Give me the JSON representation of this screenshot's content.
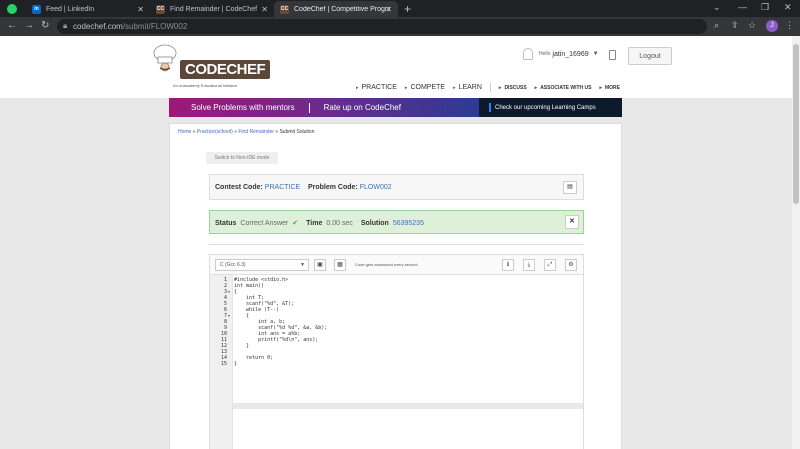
{
  "browser": {
    "tabs": [
      {
        "title": "Feed | LinkedIn",
        "favicon": "linkedin-icon"
      },
      {
        "title": "Find Remainder | CodeChef",
        "favicon": "codechef-icon"
      },
      {
        "title": "CodeChef | Competitive Programm",
        "favicon": "codechef-icon"
      }
    ],
    "url_host": "codechef.com",
    "url_path": "/submit/FLOW002",
    "profile_initial": "J"
  },
  "header": {
    "logo_text": "CODECHEF",
    "logo_sub": "An unacademy Educational Initiative",
    "hello": "Hello",
    "username": "jatin_16969",
    "logout_label": "Logout",
    "nav": [
      "PRACTICE",
      "COMPETE",
      "LEARN"
    ],
    "nav_small": [
      "DISCUSS",
      "ASSOCIATE WITH US",
      "MORE"
    ]
  },
  "banner": {
    "left1": "Solve Problems with mentors",
    "left2": "Rate up on CodeChef",
    "right": "Check our upcoming Learning Camps"
  },
  "breadcrumb": {
    "home": "Home",
    "practice": "Practice(school)",
    "problem": "Find Remainder",
    "current": "Submit Solution",
    "sep": " » "
  },
  "switch_label": "Switch to Non-IDE mode",
  "contest": {
    "contest_label": "Contest Code:",
    "contest_value": "PRACTICE",
    "problem_label": "Problem Code:",
    "problem_value": "FLOW002"
  },
  "status": {
    "status_label": "Status",
    "status_value": "Correct Answer",
    "time_label": "Time",
    "time_value": "0.00 sec",
    "solution_label": "Solution",
    "solution_value": "56395235"
  },
  "editor": {
    "language": "C (Gcc 6.3)",
    "autosave_text": "Code gets autosaved every second",
    "line_numbers": [
      "1",
      "2",
      "3",
      "4",
      "5",
      "6",
      "7",
      "8",
      "9",
      "10",
      "11",
      "12",
      "13",
      "14",
      "15"
    ],
    "lines": [
      "#include <stdio.h>",
      "int main()",
      "{",
      "    int T;",
      "    scanf(\"%d\", &T);",
      "    while (T--)",
      "    {",
      "        int a, b;",
      "        scanf(\"%d %d\", &a, &b);",
      "        int ans = a%b;",
      "        printf(\"%d\\n\", ans);",
      "    }",
      "",
      "    return 0;",
      "}"
    ]
  },
  "colors": {
    "brand_brown": "#5b4638",
    "link_blue": "#3a6fb8",
    "success_bg": "#dff0d8",
    "success_border": "#9ad29a"
  }
}
